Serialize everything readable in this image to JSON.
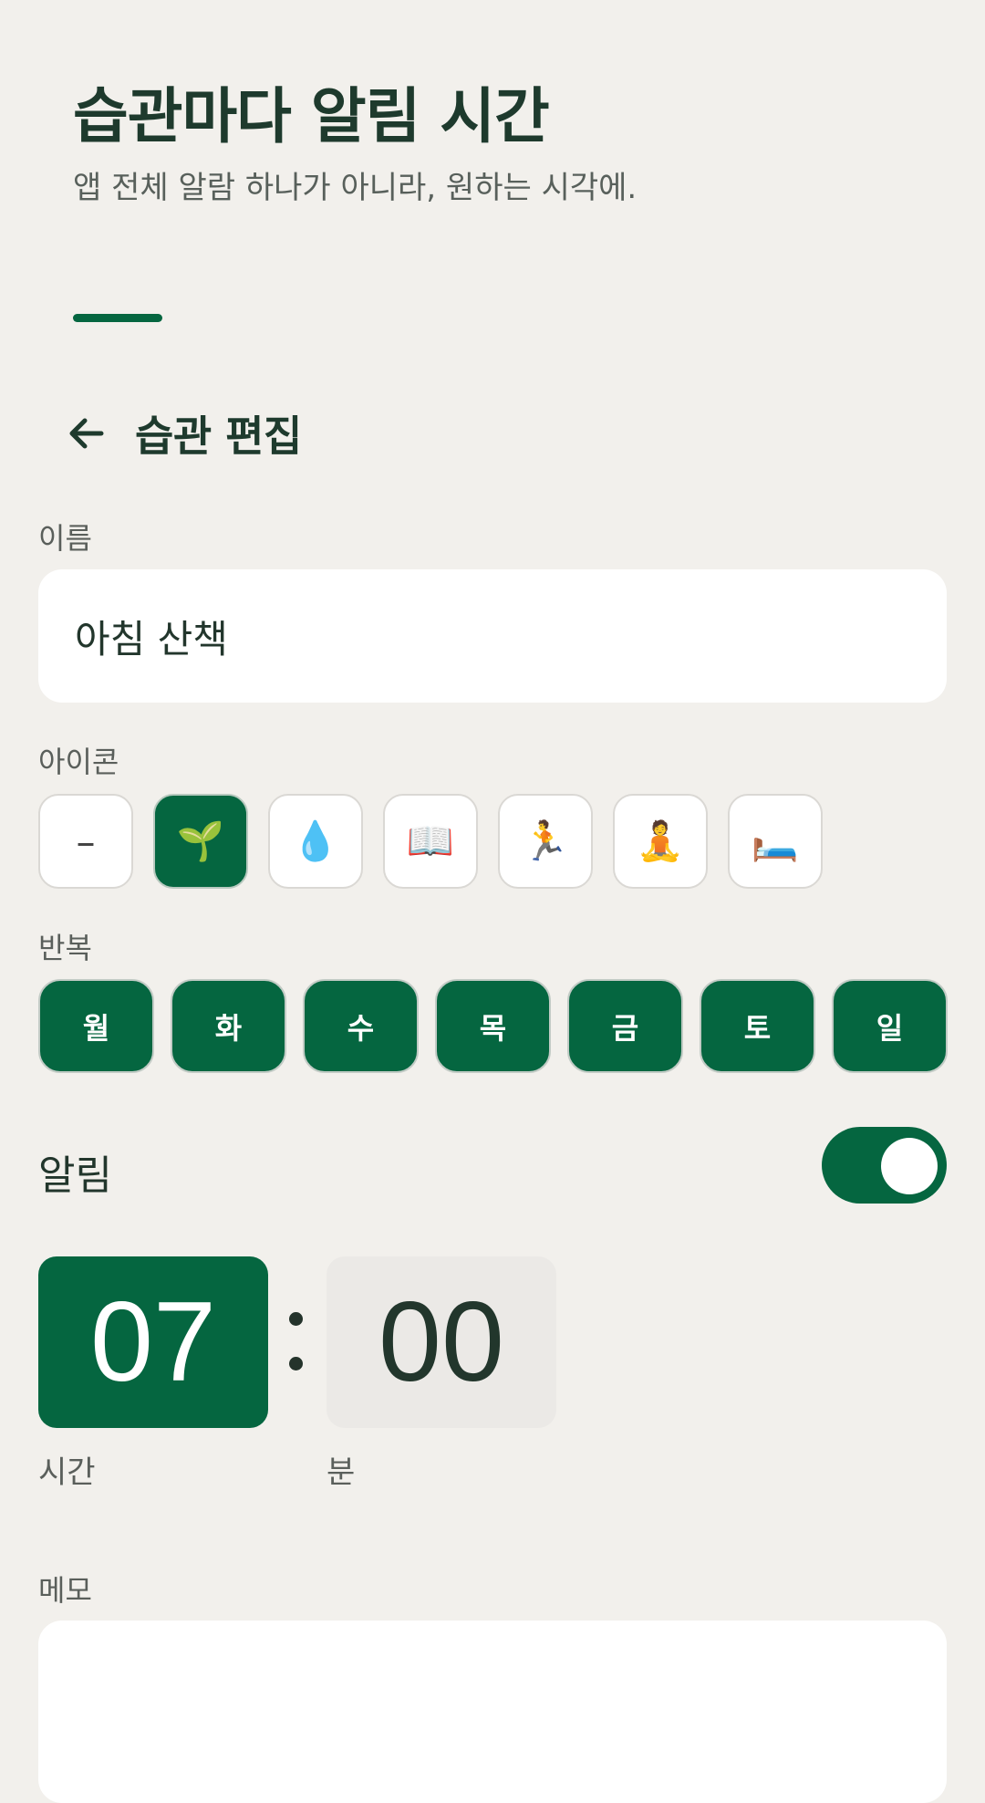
{
  "hero": {
    "title": "습관마다 알림 시간",
    "subtitle": "앱 전체 알람 하나가 아니라, 원하는 시각에."
  },
  "header": {
    "title": "습관 편집"
  },
  "name_field": {
    "label": "이름",
    "value": "아침 산책"
  },
  "icon_picker": {
    "label": "아이콘",
    "options": [
      {
        "glyph": "–",
        "name": "none-icon"
      },
      {
        "glyph": "🌱",
        "name": "seedling-icon",
        "selected": true
      },
      {
        "glyph": "💧",
        "name": "water-drop-icon"
      },
      {
        "glyph": "📖",
        "name": "open-book-icon"
      },
      {
        "glyph": "🏃",
        "name": "running-person-icon"
      },
      {
        "glyph": "🧘",
        "name": "meditation-icon"
      },
      {
        "glyph": "🛏️",
        "name": "bed-icon"
      }
    ]
  },
  "repeat": {
    "label": "반복",
    "days": [
      "월",
      "화",
      "수",
      "목",
      "금",
      "토",
      "일"
    ]
  },
  "alarm": {
    "label": "알림",
    "enabled": true
  },
  "time": {
    "hour": "07",
    "minute": "00",
    "hour_label": "시간",
    "minute_label": "분"
  },
  "memo": {
    "label": "메모",
    "value": ""
  },
  "colors": {
    "accent": "#056640",
    "background": "#f2f0ec",
    "text": "#1e3a2d"
  }
}
